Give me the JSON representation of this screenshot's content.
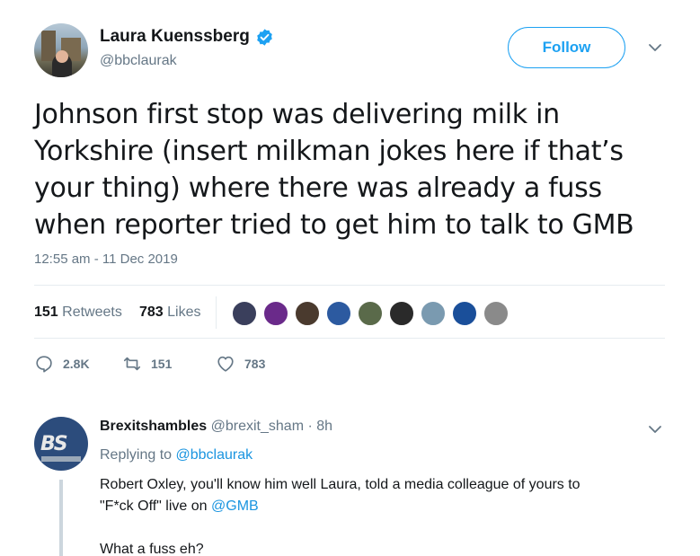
{
  "tweet": {
    "author": {
      "display_name": "Laura Kuenssberg",
      "handle": "@bbclaurak",
      "verified": true
    },
    "follow_label": "Follow",
    "text_lines": [
      "Johnson first stop was delivering milk in",
      "Yorkshire (insert milkman jokes here if that’s",
      "your thing) where there was already a fuss",
      "when reporter tried to get him to talk to GMB"
    ],
    "timestamp": "12:55 am - 11 Dec 2019",
    "stats": {
      "retweets_count": "151",
      "retweets_label": "Retweets",
      "likes_count": "783",
      "likes_label": "Likes"
    },
    "liker_avatars": [
      {
        "icon": "liker-avatar",
        "color": "#3a3f5c"
      },
      {
        "icon": "liker-avatar",
        "color": "#6a2a8a"
      },
      {
        "icon": "liker-avatar",
        "color": "#4a3a2e"
      },
      {
        "icon": "liker-avatar",
        "color": "#2c5aa0"
      },
      {
        "icon": "liker-avatar",
        "color": "#5a6a4a"
      },
      {
        "icon": "liker-avatar",
        "color": "#2a2a2a"
      },
      {
        "icon": "liker-avatar",
        "color": "#7a9ab0"
      },
      {
        "icon": "liker-avatar",
        "color": "#1a4f9a"
      },
      {
        "icon": "liker-avatar",
        "color": "#8a8a8a"
      }
    ],
    "actions": {
      "reply_count": "2.8K",
      "retweet_count": "151",
      "like_count": "783"
    }
  },
  "reply": {
    "display_name": "Brexitshambles",
    "handle": "@brexit_sham",
    "separator": "·",
    "time": "8h",
    "avatar_text": "BS",
    "replying_prefix": "Replying to",
    "replying_to": "@bbclaurak",
    "body_line1": "Robert Oxley, you'll know him well Laura, told a media colleague of yours to",
    "body_line2_prefix": "\"F*ck Off\" live on",
    "body_mention": "@GMB",
    "body_line3": "What a fuss eh?"
  },
  "colors": {
    "accent": "#1da1f2",
    "link": "#1b95e0",
    "muted": "#657786",
    "text": "#14171a"
  }
}
